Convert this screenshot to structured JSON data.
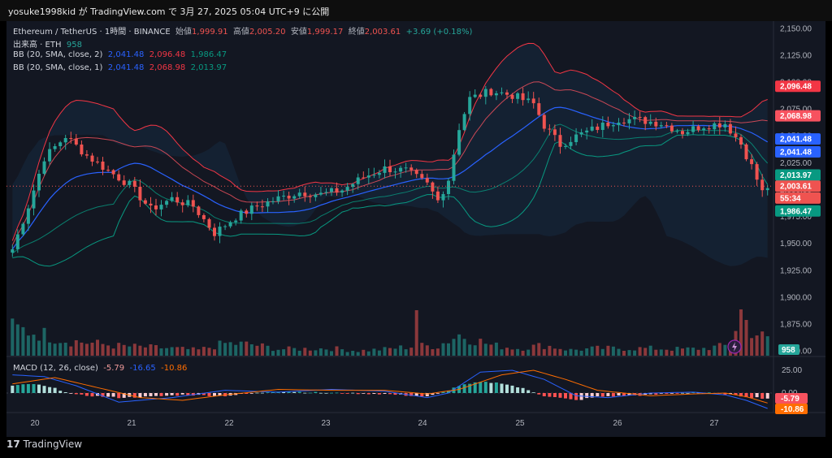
{
  "header": {
    "text": "yosuke1998kid が TradingView.com で 3月 27, 2025 05:04 UTC+9 に公開"
  },
  "legend": {
    "symbol": "Ethereum / TetherUS · 1時間 · BINANCE",
    "open_label": "始値",
    "open": "1,999.91",
    "high_label": "高値",
    "high": "2,005.20",
    "low_label": "安値",
    "low": "1,999.17",
    "close_label": "終値",
    "close": "2,003.61",
    "change": "+3.69 (+0.18%)",
    "volume_label": "出来高 · ETH",
    "volume": "958",
    "bb2_label": "BB (20, SMA, close, 2)",
    "bb2_basis": "2,041.48",
    "bb2_upper": "2,096.48",
    "bb2_lower": "1,986.47",
    "bb1_label": "BB (20, SMA, close, 1)",
    "bb1_basis": "2,041.48",
    "bb1_upper": "2,068.98",
    "bb1_lower": "2,013.97",
    "macd_label": "MACD (12, 26, close)",
    "macd_hist": "-5.79",
    "macd_line": "-16.65",
    "macd_signal": "-10.86"
  },
  "footer": {
    "brand": "TradingView"
  },
  "colors": {
    "up": "#26a69a",
    "down": "#ef5350",
    "bb2": "#f23645",
    "bb1": "#f7525f",
    "basis": "#2962ff",
    "lower": "#089981",
    "macd": "#2962ff",
    "signal": "#ff6d00"
  },
  "chart_data": {
    "type": "candlestick",
    "title": "Ethereum / TetherUS · 1時間 · BINANCE",
    "y_ticks": [
      "2,150.00",
      "2,125.00",
      "2,100.00",
      "2,075.00",
      "2,050.00",
      "2,025.00",
      "2,000.00",
      "1,975.00",
      "1,950.00",
      "1,925.00",
      "1,900.00",
      "1,875.00",
      "1,850.00"
    ],
    "ylim": [
      1846,
      2157
    ],
    "x_ticks": [
      "20",
      "21",
      "22",
      "23",
      "24",
      "25",
      "26",
      "27"
    ],
    "price_labels": [
      {
        "text": "2,096.48",
        "value": 2096.48,
        "color": "#f23645"
      },
      {
        "text": "2,068.98",
        "value": 2068.98,
        "color": "#f7525f"
      },
      {
        "text": "2,041.48",
        "value": 2047.5,
        "color": "#2962ff"
      },
      {
        "text": "2,041.48",
        "value": 2035.5,
        "color": "#2962ff"
      },
      {
        "text": "2,013.97",
        "value": 2013.97,
        "color": "#089981"
      },
      {
        "text": "2,003.61",
        "value": 2003.61,
        "color": "#ef5350"
      },
      {
        "text": "55:34",
        "value": 1992.5,
        "color": "#ef5350"
      },
      {
        "text": "1,986.47",
        "value": 1980.5,
        "color": "#089981"
      }
    ],
    "volume_label": "958",
    "macd_ticks": [
      "25.00",
      "0.00"
    ],
    "macd_labels": [
      {
        "text": "-5.79",
        "color": "#f7525f"
      },
      {
        "text": "-10.86",
        "color": "#ff6d00"
      }
    ],
    "anchors_close": [
      [
        0,
        1945
      ],
      [
        3,
        1985
      ],
      [
        6,
        2030
      ],
      [
        8,
        2040
      ],
      [
        10,
        2050
      ],
      [
        14,
        2032
      ],
      [
        18,
        2018
      ],
      [
        22,
        2005
      ],
      [
        26,
        1982
      ],
      [
        30,
        1992
      ],
      [
        34,
        1985
      ],
      [
        38,
        1960
      ],
      [
        42,
        1975
      ],
      [
        46,
        1985
      ],
      [
        50,
        1992
      ],
      [
        54,
        1998
      ],
      [
        58,
        1996
      ],
      [
        62,
        2000
      ],
      [
        66,
        2012
      ],
      [
        70,
        2020
      ],
      [
        74,
        2018
      ],
      [
        78,
        2005
      ],
      [
        80,
        1990
      ],
      [
        82,
        2010
      ],
      [
        84,
        2058
      ],
      [
        86,
        2085
      ],
      [
        90,
        2092
      ],
      [
        94,
        2088
      ],
      [
        98,
        2080
      ],
      [
        100,
        2060
      ],
      [
        103,
        2042
      ],
      [
        106,
        2050
      ],
      [
        110,
        2058
      ],
      [
        114,
        2066
      ],
      [
        118,
        2065
      ],
      [
        122,
        2062
      ],
      [
        126,
        2054
      ],
      [
        130,
        2060
      ],
      [
        134,
        2062
      ],
      [
        137,
        2043
      ],
      [
        139,
        2022
      ],
      [
        141,
        1998
      ],
      [
        142,
        2003
      ]
    ],
    "anchors_volume": [
      [
        0,
        34
      ],
      [
        5,
        28
      ],
      [
        10,
        19
      ],
      [
        20,
        12
      ],
      [
        30,
        9
      ],
      [
        35,
        7
      ],
      [
        40,
        15
      ],
      [
        45,
        14
      ],
      [
        50,
        8
      ],
      [
        60,
        9
      ],
      [
        65,
        6
      ],
      [
        70,
        8
      ],
      [
        76,
        12
      ],
      [
        80,
        12
      ],
      [
        84,
        26
      ],
      [
        86,
        22
      ],
      [
        90,
        13
      ],
      [
        95,
        9
      ],
      [
        100,
        13
      ],
      [
        105,
        7
      ],
      [
        110,
        9
      ],
      [
        120,
        9
      ],
      [
        126,
        8
      ],
      [
        130,
        9
      ],
      [
        135,
        13
      ],
      [
        137,
        57
      ],
      [
        139,
        31
      ],
      [
        142,
        20
      ]
    ],
    "big_volume_bars": [
      [
        76,
        56
      ],
      [
        137,
        57
      ],
      [
        138,
        44
      ]
    ],
    "anchors_macd": [
      [
        0,
        8
      ],
      [
        4,
        10
      ],
      [
        8,
        5
      ],
      [
        12,
        -2
      ],
      [
        20,
        -5
      ],
      [
        26,
        -4
      ],
      [
        32,
        -2
      ],
      [
        40,
        -3
      ],
      [
        50,
        2
      ],
      [
        60,
        0
      ],
      [
        70,
        -1
      ],
      [
        78,
        -4
      ],
      [
        81,
        1
      ],
      [
        84,
        8
      ],
      [
        88,
        12
      ],
      [
        92,
        11
      ],
      [
        96,
        5
      ],
      [
        100,
        -3
      ],
      [
        106,
        -8
      ],
      [
        110,
        -4
      ],
      [
        120,
        -2
      ],
      [
        128,
        1
      ],
      [
        134,
        -1
      ],
      [
        138,
        -4
      ],
      [
        142,
        -6
      ]
    ],
    "anchors_macd_line": [
      [
        0,
        20
      ],
      [
        6,
        18
      ],
      [
        12,
        8
      ],
      [
        20,
        -10
      ],
      [
        30,
        -5
      ],
      [
        40,
        3
      ],
      [
        50,
        1
      ],
      [
        60,
        4
      ],
      [
        70,
        2
      ],
      [
        78,
        -5
      ],
      [
        82,
        0
      ],
      [
        88,
        23
      ],
      [
        94,
        25
      ],
      [
        100,
        15
      ],
      [
        106,
        -3
      ],
      [
        112,
        -5
      ],
      [
        120,
        0
      ],
      [
        128,
        1
      ],
      [
        134,
        -2
      ],
      [
        138,
        -8
      ],
      [
        142,
        -17
      ]
    ],
    "anchors_macd_signal": [
      [
        0,
        10
      ],
      [
        8,
        17
      ],
      [
        16,
        6
      ],
      [
        24,
        -5
      ],
      [
        32,
        -8
      ],
      [
        40,
        -2
      ],
      [
        50,
        4
      ],
      [
        60,
        3
      ],
      [
        70,
        3
      ],
      [
        78,
        -1
      ],
      [
        84,
        4
      ],
      [
        92,
        20
      ],
      [
        98,
        25
      ],
      [
        104,
        15
      ],
      [
        110,
        3
      ],
      [
        120,
        -3
      ],
      [
        128,
        -1
      ],
      [
        134,
        0
      ],
      [
        138,
        -4
      ],
      [
        142,
        -11
      ]
    ]
  }
}
